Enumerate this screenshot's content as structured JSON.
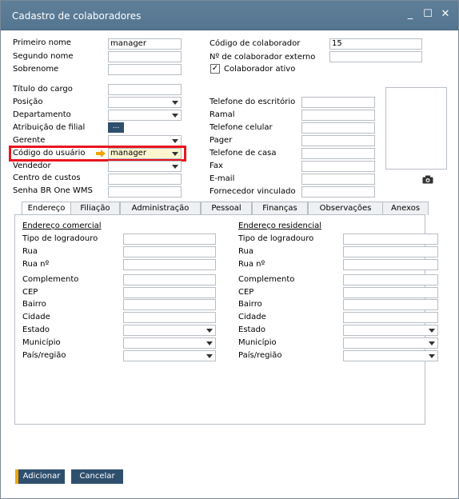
{
  "window": {
    "title": "Cadastro de colaboradores",
    "minimize": "_",
    "maximize": "☐",
    "close": "✕"
  },
  "personal": {
    "primeiro_nome_label": "Primeiro nome",
    "primeiro_nome_value": "manager",
    "segundo_nome_label": "Segundo nome",
    "sobrenome_label": "Sobrenome",
    "codigo_colaborador_label": "Código de colaborador",
    "codigo_colaborador_value": "15",
    "colaborador_externo_label": "Nº de colaborador externo",
    "colaborador_ativo_label": "Colaborador ativo",
    "colaborador_ativo_checked": true
  },
  "job": {
    "titulo_cargo_label": "Título do cargo",
    "posicao_label": "Posição",
    "departamento_label": "Departamento",
    "atribuicao_filial_label": "Atribuição de filial",
    "atribuicao_filial_button": "...",
    "gerente_label": "Gerente",
    "codigo_usuario_label": "Código do usuário",
    "codigo_usuario_value": "manager",
    "vendedor_label": "Vendedor",
    "centro_custos_label": "Centro de custos",
    "senha_label": "Senha BR One WMS"
  },
  "contact": {
    "tel_escritorio_label": "Telefone do escritório",
    "ramal_label": "Ramal",
    "tel_celular_label": "Telefone celular",
    "pager_label": "Pager",
    "tel_casa_label": "Telefone de casa",
    "fax_label": "Fax",
    "email_label": "E-mail",
    "fornecedor_label": "Fornecedor vinculado"
  },
  "tabs": [
    "Endereço",
    "Filiação",
    "Administração",
    "Pessoal",
    "Finanças",
    "Observações",
    "Anexos"
  ],
  "address": {
    "comercial_title": "Endereço comercial",
    "residencial_title": "Endereço residencial",
    "fields": [
      "Tipo de logradouro",
      "Rua",
      "Rua nº",
      "Complemento",
      "CEP",
      "Bairro",
      "Cidade",
      "Estado",
      "Município",
      "País/região"
    ]
  },
  "buttons": {
    "add": "Adicionar",
    "cancel": "Cancelar"
  },
  "colors": {
    "titlebar": "#5a7a94",
    "button": "#2f4f6e",
    "highlight": "#e8151f",
    "accent": "#f0a500"
  }
}
